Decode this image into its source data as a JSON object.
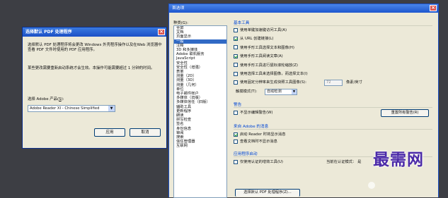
{
  "dialog": {
    "title": "选择默认 PDF 处理程序",
    "para1": "选择默认 PDF 处理程序将会更改 Windows 外壳程序操作以及在Web 浏览器中查看 PDF 文件时使用的 PDF 应用程序。",
    "para2": "某些更改需要重新启动系统才会生效。本操作可能需要超过 1 分钟的时间。",
    "product_label": "选择 Adobe 产品(",
    "product_label_key": "S",
    "product_label_end": "):",
    "product_value": "Adobe Reader XI - Chinese Simplified",
    "apply": "应用",
    "cancel": "取消"
  },
  "prefs": {
    "title": "首选项",
    "category_label": "种类(G):",
    "categories": [
      "全屏",
      "文档",
      "页面显示",
      "一般",
      "注释"
    ],
    "categories2": [
      "3D 和多媒体",
      "Adobe 联机服务",
      "JavaScript",
      "安全性",
      "安全性（增强）",
      "表单",
      "测量（2D）",
      "测量（3D）",
      "测量（几何）",
      "单位",
      "电子邮件帐户",
      "多媒体（旧版）",
      "多媒体信任（旧版）",
      "辅助工具",
      "更新程序",
      "朗读",
      "拼写检查",
      "签名",
      "身份信息",
      "审阅",
      "搜索",
      "信任管理器",
      "互联网"
    ],
    "selected_category": "一般",
    "basic_tools": {
      "title": "基本工具",
      "items": [
        {
          "label": "使用单键加速键访问工具(A)",
          "checked": false
        },
        {
          "label": "从 URL 创建链接(L)",
          "checked": true
        },
        {
          "label": "使用手形工具选择文本和图像(H)",
          "checked": false
        },
        {
          "label": "使用手形工具阅读文章(A)",
          "checked": true
        },
        {
          "label": "使用手形工具进行鼠标滚轮缩放(Z)",
          "checked": false
        },
        {
          "label": "使用选择工具来选择图像，而选择文本(I)",
          "checked": false
        },
        {
          "label": "使用固定分辨率来生成快照工具图像(S):",
          "checked": false
        }
      ],
      "resolution_value": "72",
      "resolution_unit": "像素/英寸",
      "touch_label": "触摸模式(T):",
      "touch_value": "自动检测"
    },
    "warnings": {
      "title": "警告",
      "item": "不显示编辑警告(W)",
      "reset_button": "重置所有警告(R)"
    },
    "messages": {
      "title": "来自 Adobe 的消息",
      "items": [
        {
          "label": "启动 Reader 时将显示消息",
          "checked": true
        },
        {
          "label": "查看文档时不显示消息",
          "checked": false
        }
      ]
    },
    "startup": {
      "title": "应用程序启动",
      "item": "仅使用认证的增效工具(U)",
      "mode_label": "当前在认证模式：",
      "mode_value": "是",
      "bottom_button": "选择默认 PDF 处理程序(Z)..."
    }
  },
  "watermark": "最需网"
}
